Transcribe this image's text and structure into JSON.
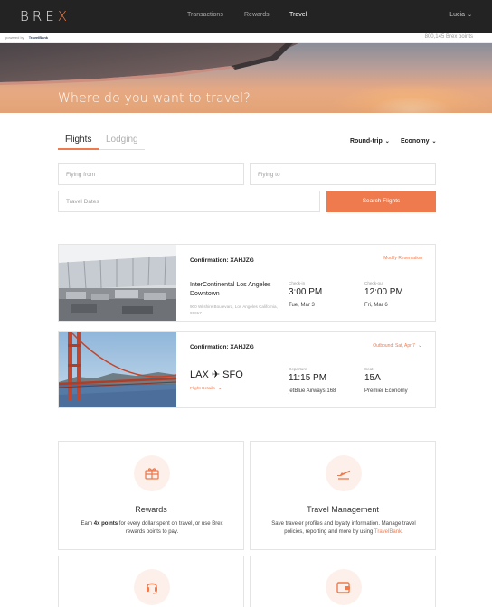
{
  "nav": {
    "logo": "BREX",
    "links": [
      "Transactions",
      "Rewards",
      "Travel"
    ],
    "active": "Travel",
    "user": "Lucia"
  },
  "subbar": {
    "powered_by": "powered by",
    "partner": "TravelBank",
    "points": "800,145 Brex points"
  },
  "hero": {
    "title": "Where do you want to travel?"
  },
  "tabs": {
    "flights": "Flights",
    "lodging": "Lodging",
    "trip_type": "Round-trip",
    "cabin": "Economy"
  },
  "form": {
    "flying_from_placeholder": "Flying from",
    "flying_to_placeholder": "Flying to",
    "dates_placeholder": "Travel Dates",
    "search_label": "Search Flights"
  },
  "hotel_card": {
    "confirmation": "Confirmation: XAHJZG",
    "action": "Modify Reservation",
    "name": "InterContinental Los Angeles Downtown",
    "address": "900 Wilshire Boulevard, Los Angeles California, 90017",
    "checkin_label": "Check-in",
    "checkin_time": "3:00 PM",
    "checkin_date": "Tue, Mar 3",
    "checkout_label": "Check-out",
    "checkout_time": "12:00 PM",
    "checkout_date": "Fri, Mar 6"
  },
  "flight_card": {
    "confirmation": "Confirmation: XAHJZG",
    "outbound": "Outbound: Sat, Apr 7",
    "origin": "LAX",
    "destination": "SFO",
    "details_label": "Flight Details",
    "departure_label": "Departure",
    "departure_time": "11:15 PM",
    "flight": "jetBlue Airways 168",
    "seat_label": "Seat",
    "seat": "15A",
    "cabin": "Premier Economy"
  },
  "tiles": {
    "rewards": {
      "title": "Rewards",
      "desc_pre": "Earn ",
      "desc_bold": "4x points",
      "desc_post": " for every dollar spent on travel, or use Brex rewards points to pay."
    },
    "travel": {
      "title": "Travel Management",
      "desc_pre": "Save traveler profiles and loyalty information. Manage travel policies, reporting and more by using ",
      "desc_link": "TravelBank",
      "desc_post": "."
    }
  },
  "colors": {
    "accent": "#ef7a4d",
    "nav_bg": "#232323",
    "tile_icon_bg": "#fdf0ea"
  },
  "icons": [
    "chevron-down-icon",
    "airplane-icon",
    "gift-icon",
    "plane-takeoff-icon",
    "headset-icon",
    "wallet-icon"
  ]
}
